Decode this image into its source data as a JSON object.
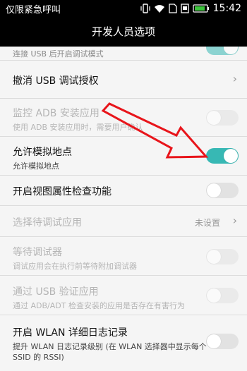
{
  "status_bar": {
    "carrier_text": "仅限紧急呼叫",
    "time": "15:42",
    "icons": [
      "vibrate-icon",
      "wifi-icon",
      "sim-card-icon",
      "screenshot-icon",
      "battery-icon"
    ]
  },
  "header": {
    "title": "开发人员选项"
  },
  "settings": {
    "usb_debug": {
      "subtitle": "连接 USB 后开启调试模式",
      "enabled": true
    },
    "revoke_usb": {
      "title": "撤消 USB 调试授权"
    },
    "monitor_adb": {
      "title": "监控 ADB 安装应用",
      "subtitle": "使用 ADB 安装应用时，需要用户确认",
      "enabled": false
    },
    "mock_location": {
      "title": "允许模拟地点",
      "subtitle": "允许模拟地点",
      "enabled": true
    },
    "view_attr": {
      "title": "开启视图属性检查功能",
      "enabled": false
    },
    "select_debug_app": {
      "title": "选择待调试应用",
      "value": "未设置"
    },
    "wait_debugger": {
      "title": "等待调试器",
      "subtitle": "调试应用会在执行前等待附加调试器",
      "enabled": false
    },
    "verify_usb_apps": {
      "title": "通过 USB 验证应用",
      "subtitle": "通过 ADB/ADT 检查安装的应用是否存在有害行为",
      "enabled": false
    },
    "wlan_log": {
      "title": "开启 WLAN 详细日志记录",
      "subtitle_line1": "提升 WLAN 日志记录级别 (在 WLAN 选择器中显示每个",
      "subtitle_line2": "SSID 的 RSSI)",
      "enabled": false
    }
  },
  "colors": {
    "switch_on": "#37b8b4",
    "annotation_arrow": "#e8151b",
    "status_bar": "#000000"
  }
}
